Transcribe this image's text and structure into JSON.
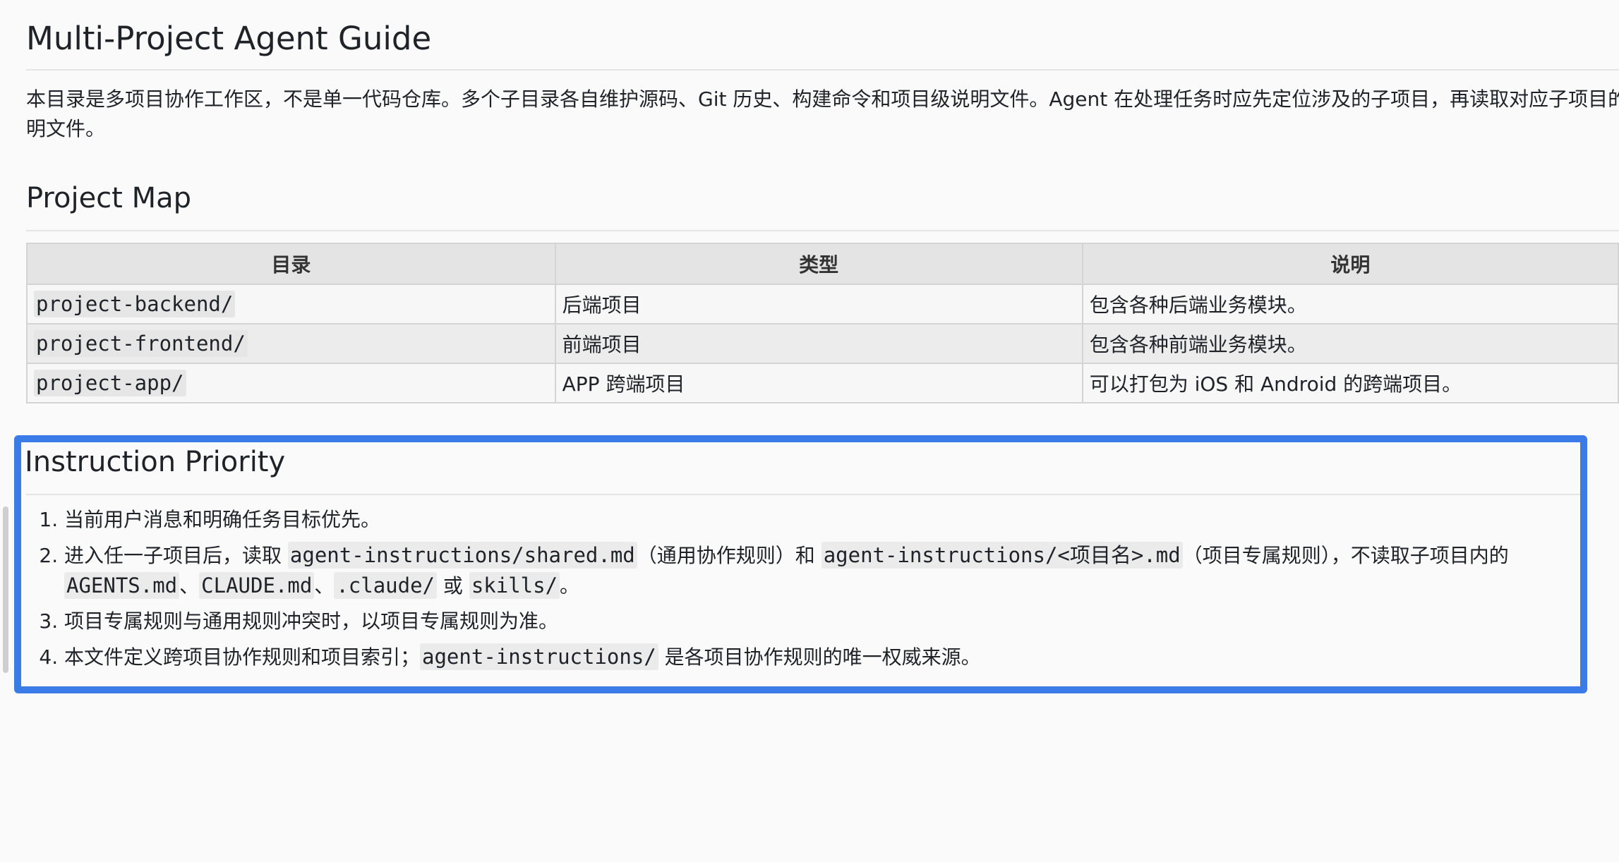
{
  "doc": {
    "title": "Multi-Project Agent Guide",
    "intro": "本目录是多项目协作工作区，不是单一代码仓库。多个子目录各自维护源码、Git 历史、构建命令和项目级说明文件。Agent 在处理任务时应先定位涉及的子项目，再读取对应子项目的说明文件。"
  },
  "project_map": {
    "heading": "Project Map",
    "columns": [
      "目录",
      "类型",
      "说明"
    ],
    "rows": [
      {
        "dir": "project-backend/",
        "type": "后端项目",
        "desc": "包含各种后端业务模块。"
      },
      {
        "dir": "project-frontend/",
        "type": "前端项目",
        "desc": "包含各种前端业务模块。"
      },
      {
        "dir": "project-app/",
        "type": "APP 跨端项目",
        "desc": "可以打包为 iOS 和 Android 的跨端项目。"
      }
    ]
  },
  "priority": {
    "heading": "Instruction Priority",
    "items": [
      {
        "text": "当前用户消息和明确任务目标优先。"
      },
      {
        "t1": "进入任一子项目后，读取 ",
        "c1": "agent-instructions/shared.md",
        "t2": "（通用协作规则）和 ",
        "c2": "agent-instructions/<项目名>.md",
        "t3": "（项目专属规则），不读取子项目内的 ",
        "c3": "AGENTS.md",
        "t4": "、",
        "c4": "CLAUDE.md",
        "t5": "、",
        "c5": ".claude/",
        "t6": " 或 ",
        "c6": "skills/",
        "t7": "。"
      },
      {
        "text": "项目专属规则与通用规则冲突时，以项目专属规则为准。"
      },
      {
        "t1": "本文件定义跨项目协作规则和项目索引；",
        "c1": "agent-instructions/",
        "t2": " 是各项目协作规则的唯一权威来源。"
      }
    ]
  },
  "colors": {
    "highlight_border": "#3a7be8"
  }
}
